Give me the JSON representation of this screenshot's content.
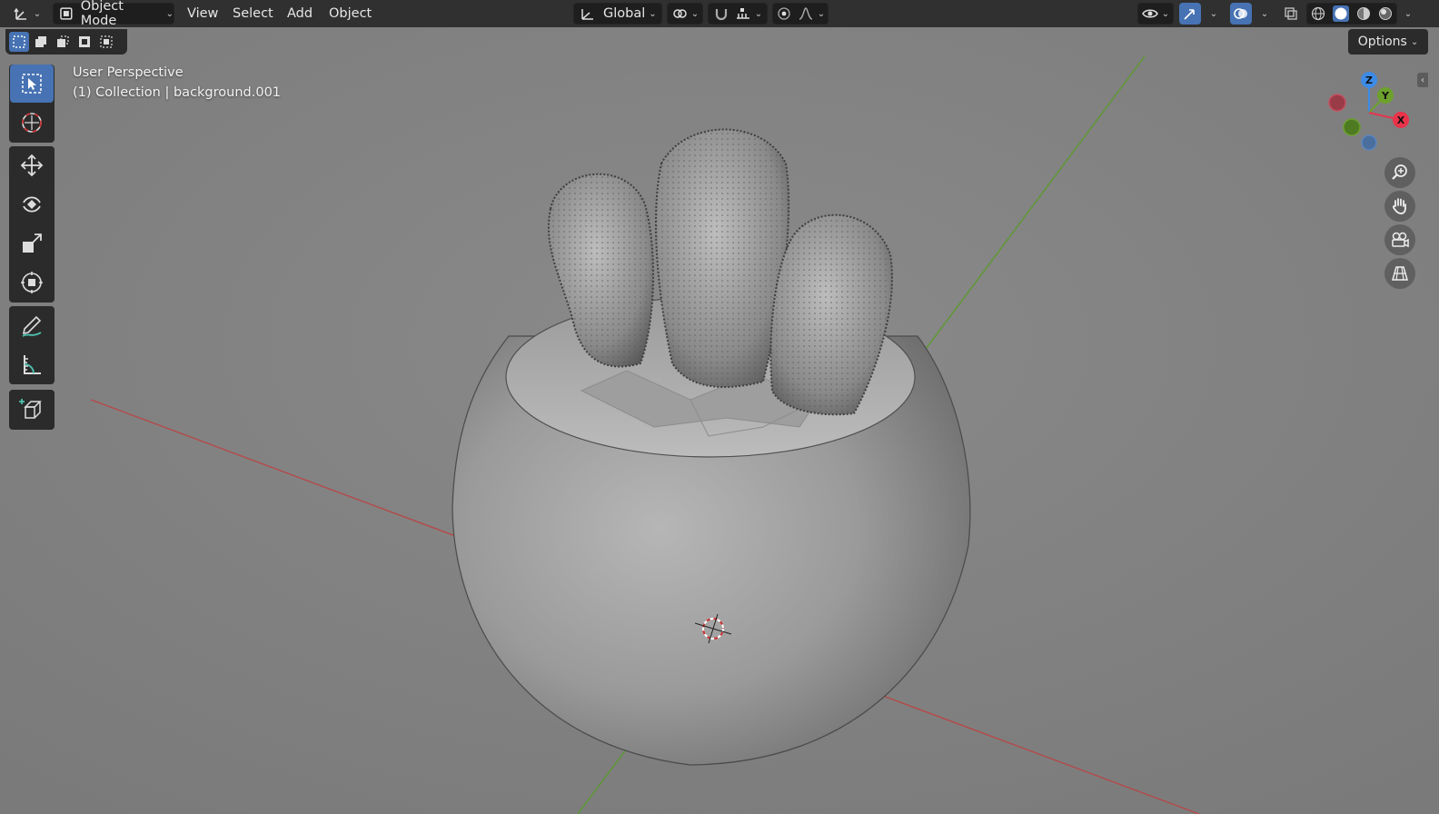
{
  "header": {
    "mode_label": "Object Mode",
    "menus": [
      "View",
      "Select",
      "Add",
      "Object"
    ],
    "transform_orientation": "Global",
    "options_label": "Options"
  },
  "viewport": {
    "perspective_label": "User Perspective",
    "collection_label": "(1) Collection | background.001"
  },
  "gizmo": {
    "x_label": "X",
    "y_label": "Y",
    "z_label": "Z",
    "x_color": "#e8334a",
    "y_color": "#6da12d",
    "z_color": "#3d8be6"
  },
  "tools": [
    {
      "name": "select-box-tool",
      "icon": "cursor-box-icon",
      "active": true
    },
    {
      "name": "cursor-tool",
      "icon": "3d-cursor-icon",
      "active": false
    },
    {
      "name": "move-tool",
      "icon": "move-arrows-icon",
      "active": false
    },
    {
      "name": "rotate-tool",
      "icon": "rotate-icon",
      "active": false
    },
    {
      "name": "scale-tool",
      "icon": "scale-icon",
      "active": false
    },
    {
      "name": "transform-tool",
      "icon": "transform-icon",
      "active": false
    },
    {
      "name": "annotate-tool",
      "icon": "pencil-icon",
      "active": false
    },
    {
      "name": "measure-tool",
      "icon": "ruler-icon",
      "active": false
    },
    {
      "name": "add-cube-tool",
      "icon": "add-cube-icon",
      "active": false
    }
  ],
  "colors": {
    "accent": "#4772b3",
    "background": "#808080",
    "x_axis_line": "#b84646",
    "y_axis_line": "#5a9a2a"
  }
}
